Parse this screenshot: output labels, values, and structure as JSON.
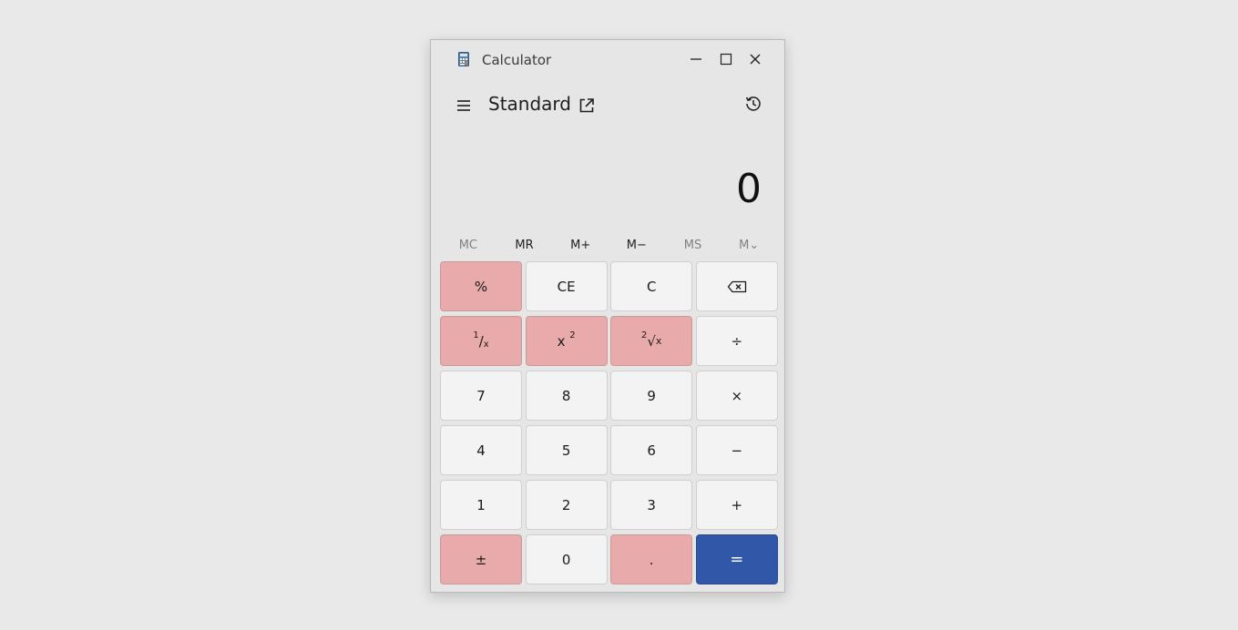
{
  "window": {
    "title": "Calculator"
  },
  "header": {
    "mode": "Standard"
  },
  "display": {
    "value": "0"
  },
  "memory": [
    "MC",
    "MR",
    "M+",
    "M−",
    "MS",
    "M⌄"
  ],
  "keys": {
    "percent": "%",
    "ce": "CE",
    "c": "C",
    "divide": "÷",
    "seven": "7",
    "eight": "8",
    "nine": "9",
    "multiply": "×",
    "four": "4",
    "five": "5",
    "six": "6",
    "minus": "−",
    "one": "1",
    "two": "2",
    "three": "3",
    "plus": "+",
    "negate": "±",
    "zero": "0",
    "decimal": ".",
    "equals": "=",
    "reciprocal": {
      "num": "1",
      "slash": "/",
      "den": "x"
    },
    "square": {
      "base": "x",
      "exp": "2"
    },
    "sqrt": {
      "index": "2",
      "radical": "√",
      "radicand": "x"
    }
  },
  "colors": {
    "highlight": "#e9aaab",
    "equals": "#3157a9",
    "background": "#e6e6e6"
  },
  "icons": [
    "calculator-icon",
    "minimize-icon",
    "maximize-icon",
    "close-icon",
    "hamburger-icon",
    "open-external-icon",
    "history-icon",
    "backspace-icon"
  ]
}
